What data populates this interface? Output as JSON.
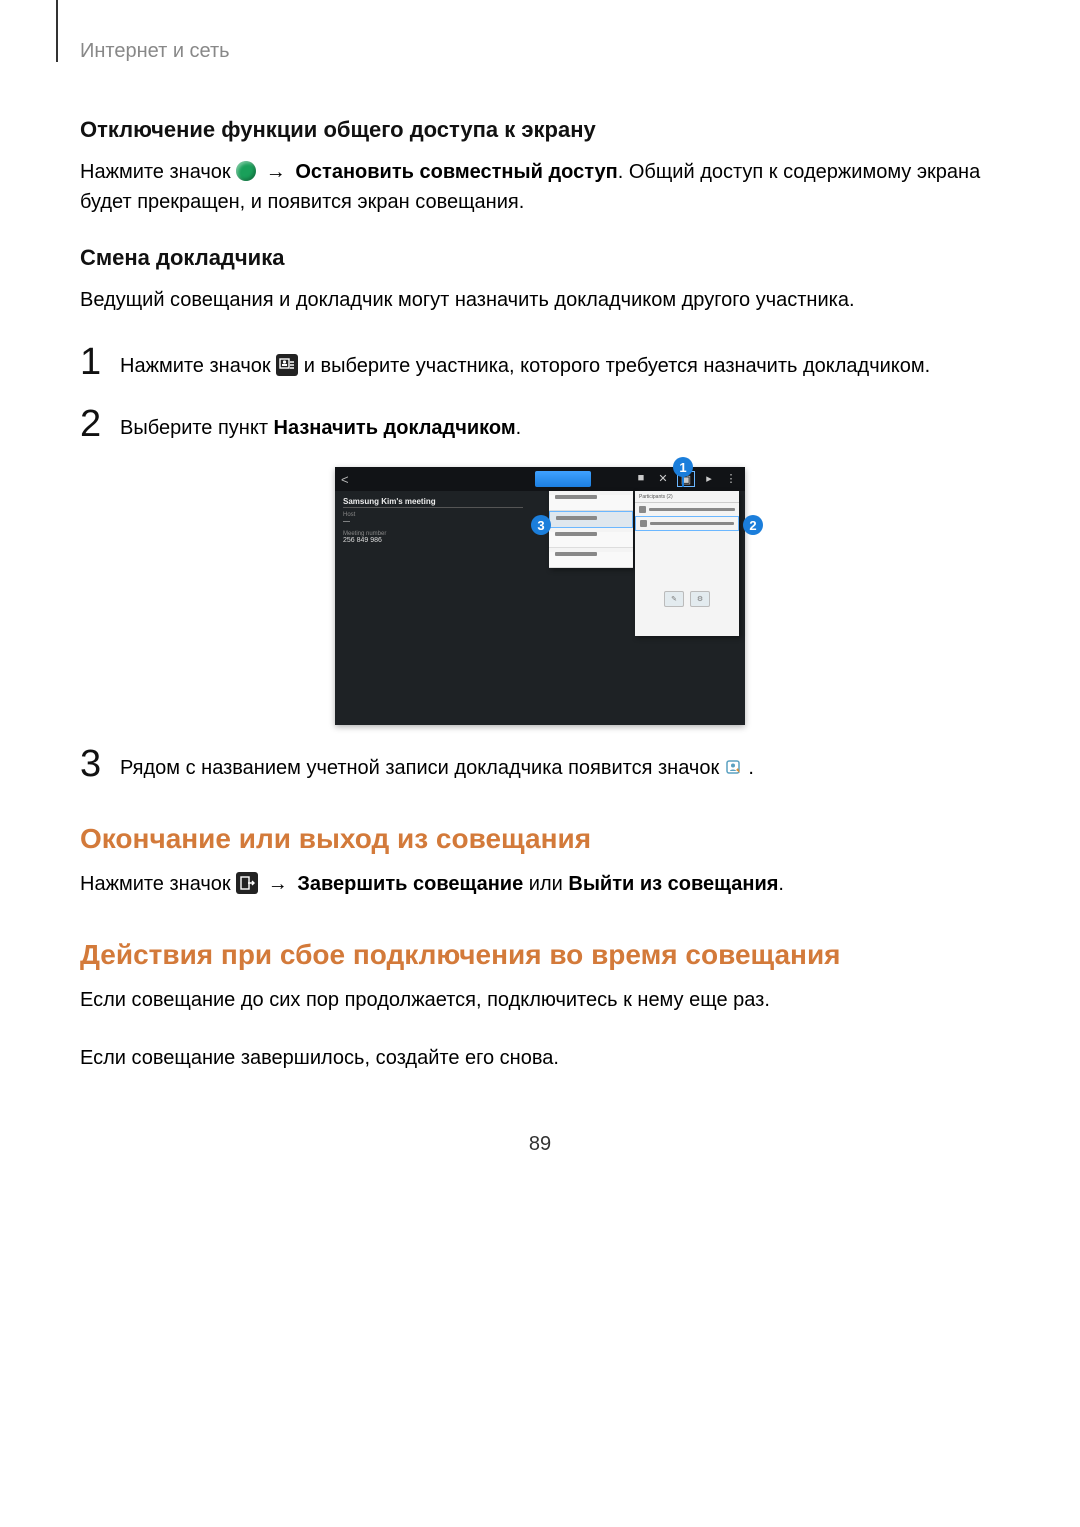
{
  "breadcrumb": "Интернет и сеть",
  "s1": {
    "heading": "Отключение функции общего доступа к экрану",
    "p_a": "Нажмите значок ",
    "p_b": " → ",
    "p_bold": "Остановить совместный доступ",
    "p_c": ". Общий доступ к содержимому экрана будет прекращен, и появится экран совещания."
  },
  "s2": {
    "heading": "Смена докладчика",
    "intro": "Ведущий совещания и докладчик могут назначить докладчиком другого участника.",
    "step1_a": "Нажмите значок ",
    "step1_b": " и выберите участника, которого требуется назначить докладчиком.",
    "step2_a": "Выберите пункт ",
    "step2_bold": "Назначить докладчиком",
    "step2_c": ".",
    "step3_a": "Рядом с названием учетной записи докладчика появится значок ",
    "step3_b": "."
  },
  "screenshot": {
    "meeting_title": "Samsung Kim's meeting",
    "host_label": "Host",
    "number_label": "Meeting number",
    "number_value": "256 849 986",
    "panel_header": "Participants (2)",
    "callout1": "1",
    "callout2": "2",
    "callout3": "3"
  },
  "s3": {
    "heading": "Окончание или выход из совещания",
    "p_a": "Нажмите значок ",
    "p_b": " → ",
    "p_bold1": "Завершить совещание",
    "p_mid": " или ",
    "p_bold2": "Выйти из совещания",
    "p_c": "."
  },
  "s4": {
    "heading": "Действия при сбое подключения во время совещания",
    "p1": "Если совещание до сих пор продолжается, подключитесь к нему еще раз.",
    "p2": "Если совещание завершилось, создайте его снова."
  },
  "page_number": "89"
}
